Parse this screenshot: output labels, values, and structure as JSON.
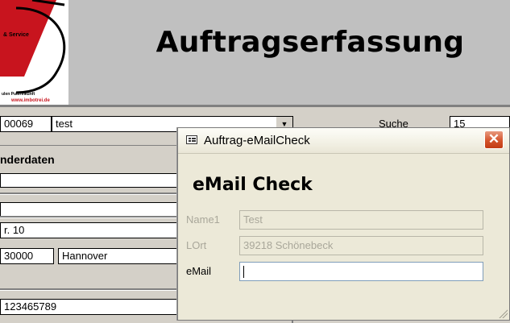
{
  "background_form": {
    "title": "Auftragserfassung",
    "logo": {
      "line1": "& Service",
      "line2": "ulen Puterinkunft",
      "line3": "www.imbotrei.de"
    },
    "top_record": {
      "id_partial": "00069",
      "name": "test"
    },
    "search": {
      "label": "Suche",
      "value": "15"
    },
    "section_label": "nderdaten",
    "street_partial": "r. 10",
    "zip_partial": "30000",
    "city": "Hannover",
    "phone_partial": "123465789"
  },
  "dialog": {
    "title": "Auftrag-eMailCheck",
    "close_glyph": "✕",
    "heading": "eMail Check",
    "fields": [
      {
        "label": "Name1",
        "value": "Test",
        "enabled": false
      },
      {
        "label": "LOrt",
        "value": "39218 Schönebeck",
        "enabled": false
      },
      {
        "label": "eMail",
        "value": "",
        "enabled": true
      }
    ]
  },
  "colors": {
    "form_background": "#c0c0c0",
    "dialog_background": "#ece9d8",
    "close_button": "#d4542c",
    "logo_red": "#c8141e"
  }
}
